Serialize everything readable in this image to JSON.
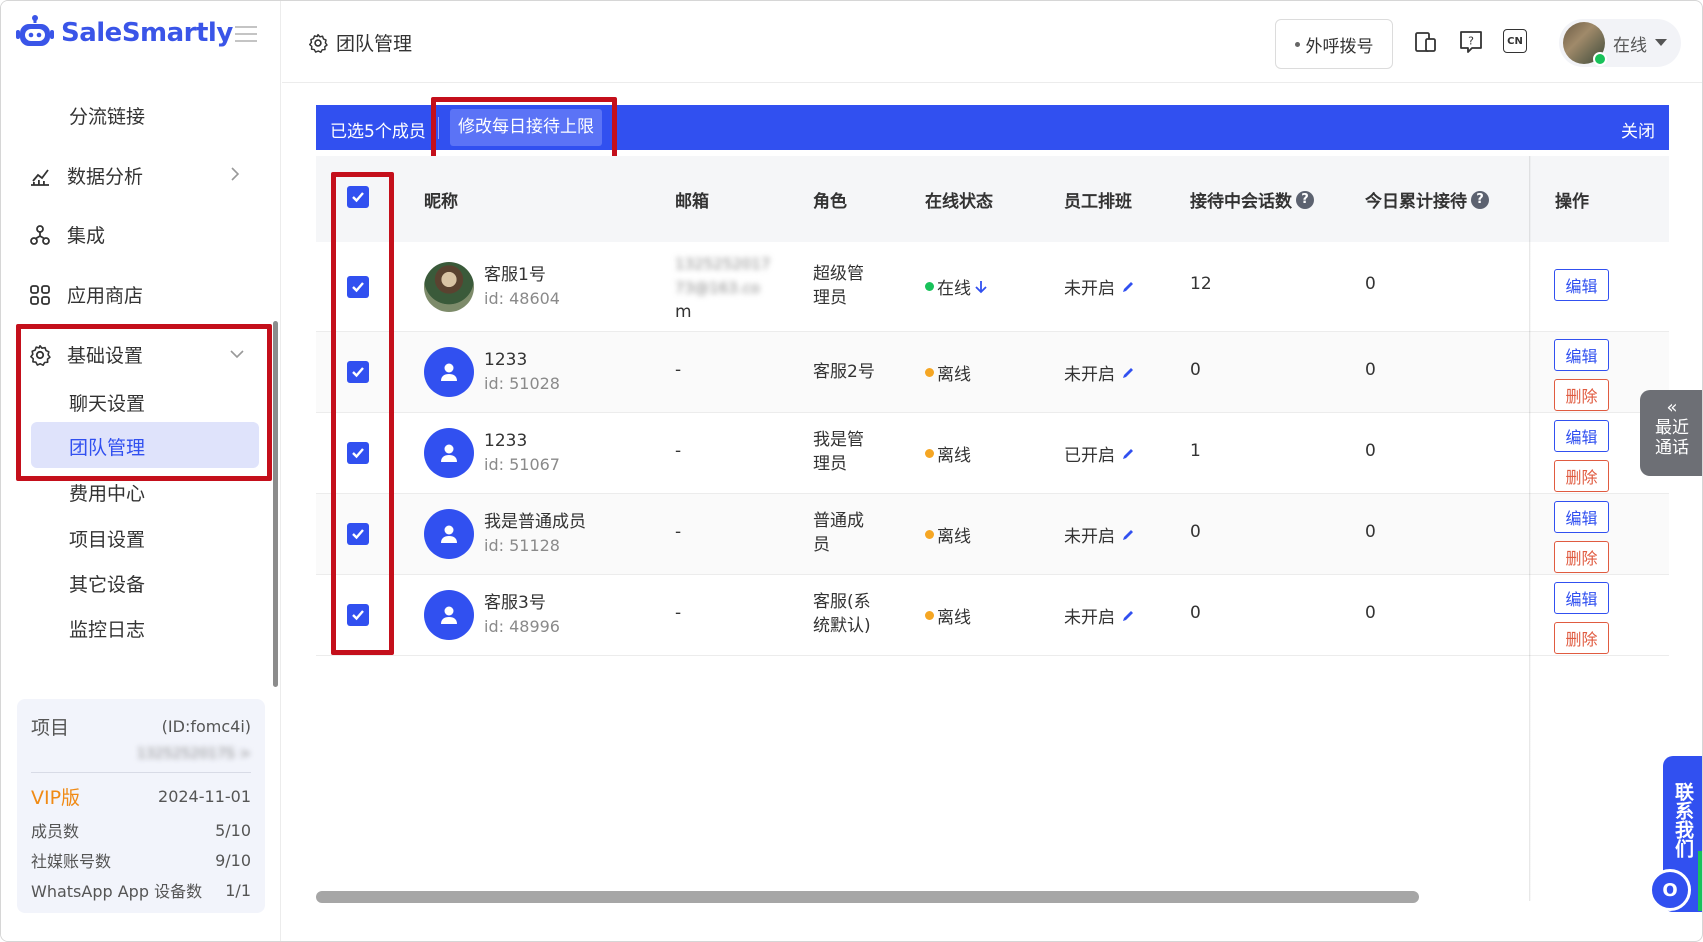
{
  "app": {
    "logo_text": "SaleSmartly"
  },
  "sidebar": {
    "items": [
      {
        "label": "分流链接"
      },
      {
        "label": "数据分析"
      },
      {
        "label": "集成"
      },
      {
        "label": "应用商店"
      },
      {
        "label": "基础设置"
      }
    ],
    "sub_items": [
      {
        "label": "聊天设置"
      },
      {
        "label": "团队管理"
      },
      {
        "label": "费用中心"
      },
      {
        "label": "项目设置"
      },
      {
        "label": "其它设备"
      },
      {
        "label": "监控日志"
      }
    ],
    "project": {
      "label": "项目",
      "id": "(ID:fomc4i)",
      "blurred_name": "1325252017S >",
      "plan": "VIP版",
      "expiry": "2024-11-01",
      "stats": [
        {
          "label": "成员数",
          "value": "5/10"
        },
        {
          "label": "社媒账号数",
          "value": "9/10"
        },
        {
          "label": "WhatsApp App 设备数",
          "value": "1/1"
        }
      ]
    }
  },
  "header": {
    "title": "团队管理",
    "call_button": "外呼拨号",
    "user_status": "在线",
    "lang_badge": "CN"
  },
  "selection_bar": {
    "selected_text": "已选5个成员",
    "edit_limit_button": "修改每日接待上限",
    "close": "关闭"
  },
  "table": {
    "headers": [
      "昵称",
      "邮箱",
      "角色",
      "在线状态",
      "员工排班",
      "接待中会话数",
      "今日累计接待",
      "操作"
    ],
    "rows": [
      {
        "name": "客服1号",
        "id": "id: 48604",
        "email_blur1": "1325252017",
        "email_blur2": "73@163.co",
        "email_tail": "m",
        "role1": "超级管",
        "role2": "理员",
        "status": "在线",
        "status_color": "#19c25a",
        "schedule": "未开启",
        "active": "12",
        "today": "0",
        "edit": "编辑",
        "delete": ""
      },
      {
        "name": "1233",
        "id": "id: 51028",
        "email": "-",
        "role1": "客服2号",
        "role2": "",
        "status": "离线",
        "status_color": "#f5a623",
        "schedule": "未开启",
        "active": "0",
        "today": "0",
        "edit": "编辑",
        "delete": "删除"
      },
      {
        "name": "1233",
        "id": "id: 51067",
        "email": "-",
        "role1": "我是管",
        "role2": "理员",
        "status": "离线",
        "status_color": "#f5a623",
        "schedule": "已开启",
        "active": "1",
        "today": "0",
        "edit": "编辑",
        "delete": "删除"
      },
      {
        "name": "我是普通成员",
        "id": "id: 51128",
        "email": "-",
        "role1": "普通成",
        "role2": "员",
        "status": "离线",
        "status_color": "#f5a623",
        "schedule": "未开启",
        "active": "0",
        "today": "0",
        "edit": "编辑",
        "delete": "删除"
      },
      {
        "name": "客服3号",
        "id": "id: 48996",
        "email": "-",
        "role1": "客服(系",
        "role2": "统默认)",
        "status": "离线",
        "status_color": "#f5a623",
        "schedule": "未开启",
        "active": "0",
        "today": "0",
        "edit": "编辑",
        "delete": "删除"
      }
    ]
  },
  "widgets": {
    "recent_calls_1": "最近",
    "recent_calls_2": "通话",
    "contact_us": "联系我们"
  },
  "colors": {
    "primary": "#3150f0",
    "highlight_red": "#c40f1b",
    "online": "#19c25a",
    "offline": "#f5a623",
    "danger": "#e05b40"
  }
}
